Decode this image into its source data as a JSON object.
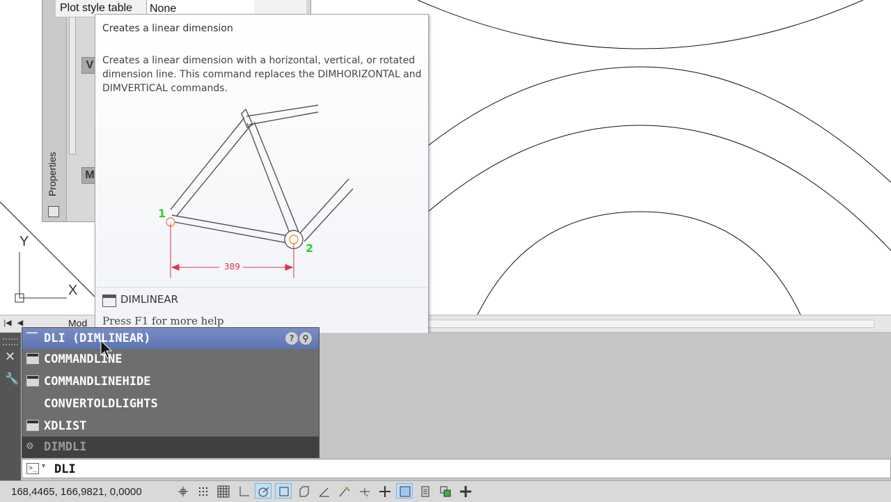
{
  "properties": {
    "vertical_title": "Properties",
    "plot_style_label": "Plot style table",
    "plot_style_value": "None",
    "section_v": "V",
    "section_m": "M"
  },
  "tooltip": {
    "title": "Creates a linear dimension",
    "description": "Creates a linear dimension with a horizontal, vertical, or rotated dimension line. This command replaces the DIMHORIZONTAL and DIMVERTICAL commands.",
    "point1": "1",
    "point2": "2",
    "dimension_value": "389",
    "command_name": "DIMLINEAR",
    "help_text": "Press F1 for more help"
  },
  "canvas": {
    "ucs_y": "Y",
    "ucs_x": "X"
  },
  "layout_tabs": {
    "model_tab": "Mod"
  },
  "autocomplete": {
    "items": [
      {
        "label": "DLI (DIMLINEAR)",
        "icon": "dimlinear-icon",
        "selected": true
      },
      {
        "label": "COMMANDLINE",
        "icon": "commandline-icon"
      },
      {
        "label": "COMMANDLINEHIDE",
        "icon": "commandlinehide-icon"
      },
      {
        "label": "CONVERTOLDLIGHTS",
        "icon": ""
      },
      {
        "label": "XDLIST",
        "icon": "xdlist-icon"
      },
      {
        "label": "DIMDLI",
        "icon": "gear-icon",
        "dimmed": true
      }
    ]
  },
  "command_line": {
    "value": "DLI"
  },
  "status": {
    "coordinates": "168,4465, 166,9821, 0,0000"
  },
  "colors": {
    "selected_row": "#6a80bd",
    "dimension_red": "#e0334a",
    "point_green": "#33cc33"
  }
}
